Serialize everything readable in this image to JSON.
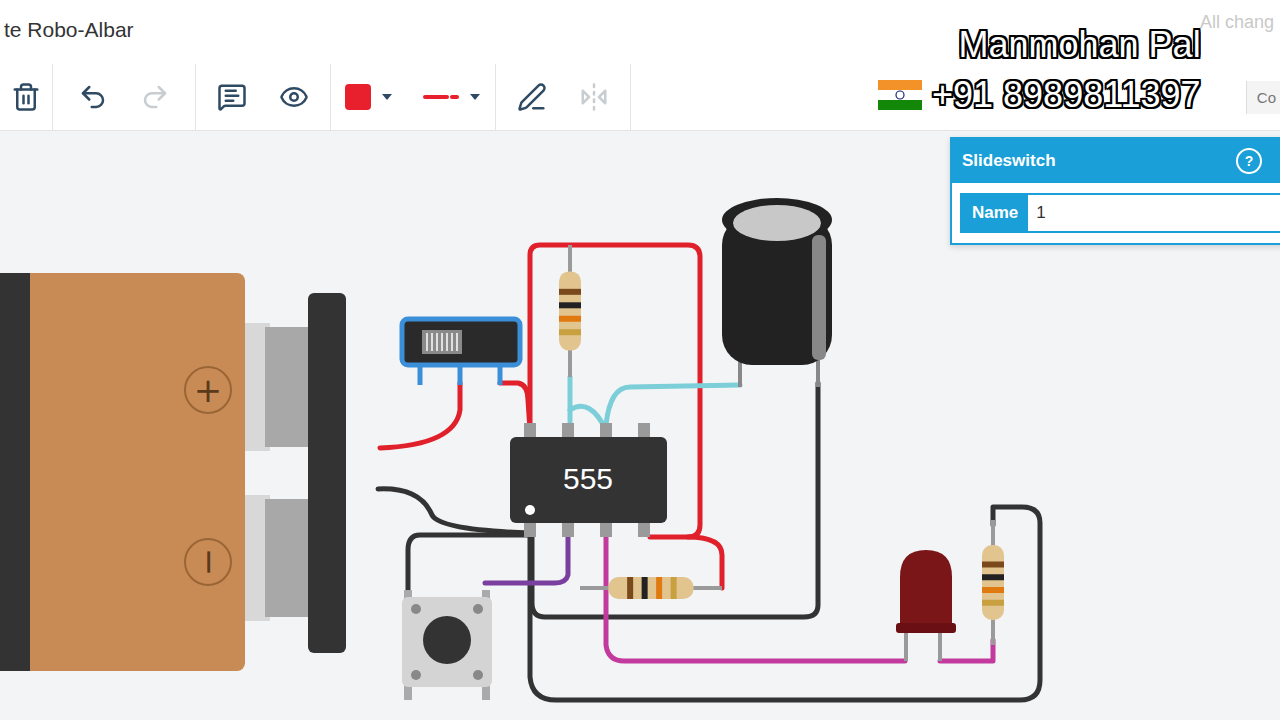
{
  "header": {
    "title": "te Robo-Albar",
    "save_status": "All chang"
  },
  "toolbar": {
    "groups": [
      {
        "tools": [
          {
            "kind": "delete",
            "disabled": false
          }
        ]
      },
      {
        "tools": [
          {
            "kind": "undo",
            "disabled": false
          },
          {
            "kind": "redo",
            "disabled": true
          }
        ]
      },
      {
        "tools": [
          {
            "kind": "note",
            "disabled": false
          },
          {
            "kind": "view",
            "disabled": false
          }
        ]
      },
      {
        "tools": [
          {
            "kind": "fill",
            "disabled": false,
            "color": "#e8202e"
          },
          {
            "kind": "line",
            "disabled": false,
            "color": "#e8202e"
          }
        ]
      },
      {
        "tools": [
          {
            "kind": "draw",
            "disabled": false
          },
          {
            "kind": "mirror",
            "disabled": true
          }
        ]
      }
    ],
    "code_button": "Co"
  },
  "watermark": {
    "name": "Manmohan Pal",
    "phone": "+91 8989811397"
  },
  "inspector": {
    "title": "Slideswitch",
    "help": "?",
    "fields": [
      {
        "label": "Name",
        "value": "1"
      }
    ]
  },
  "circuit": {
    "chip_label": "555",
    "battery_marks": [
      "+",
      "−"
    ]
  }
}
